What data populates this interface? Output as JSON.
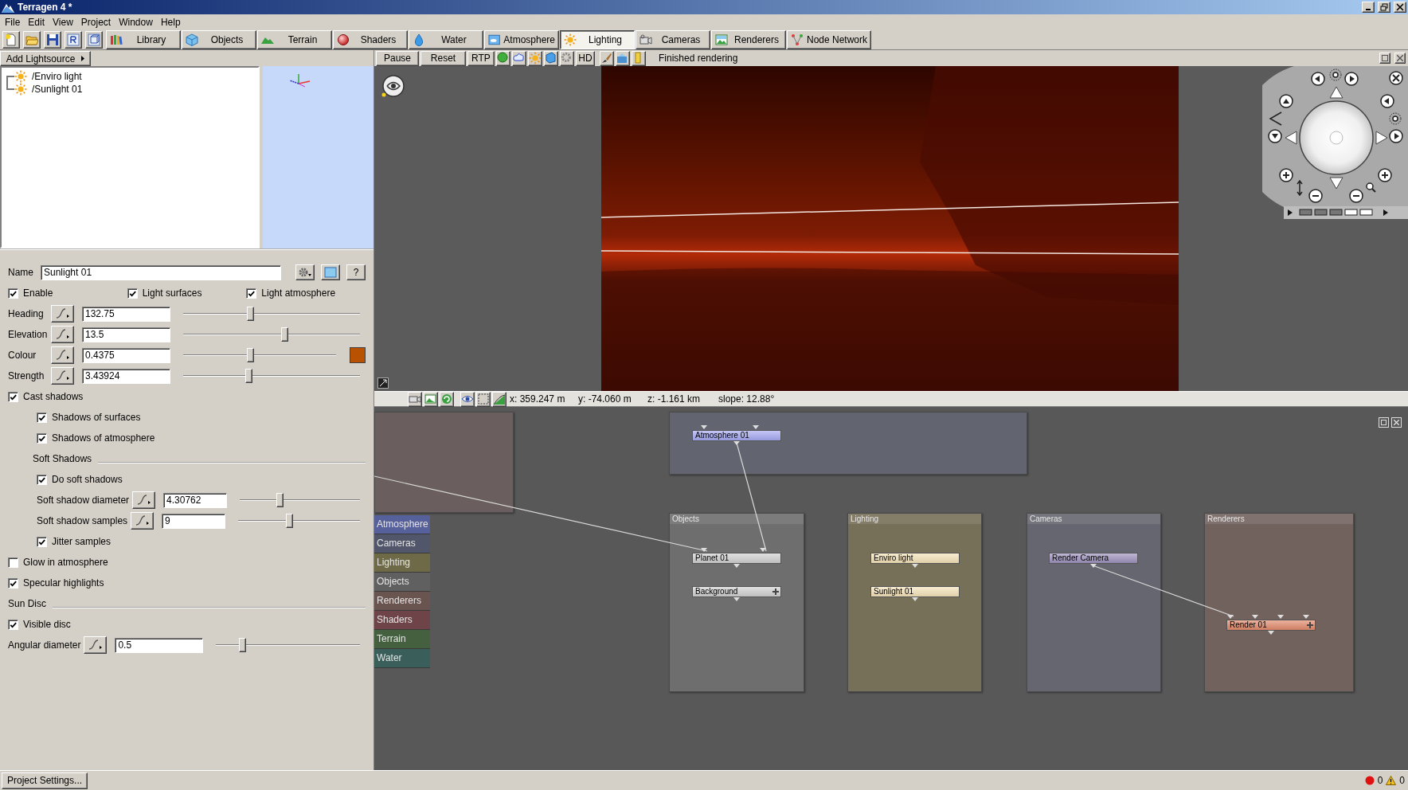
{
  "window": {
    "title": "Terragen 4 *"
  },
  "menu": [
    "File",
    "Edit",
    "View",
    "Project",
    "Window",
    "Help"
  ],
  "toolbar": {
    "tabs": [
      {
        "label": "Library",
        "selected": false
      },
      {
        "label": "Objects",
        "selected": false
      },
      {
        "label": "Terrain",
        "selected": false
      },
      {
        "label": "Shaders",
        "selected": false
      },
      {
        "label": "Water",
        "selected": false
      },
      {
        "label": "Atmosphere",
        "selected": false
      },
      {
        "label": "Lighting",
        "selected": true
      },
      {
        "label": "Cameras",
        "selected": false
      },
      {
        "label": "Renderers",
        "selected": false
      },
      {
        "label": "Node Network",
        "selected": false
      }
    ]
  },
  "light_list": {
    "add_button": "Add Lightsource",
    "items": [
      {
        "label": "/Enviro light",
        "selected": false
      },
      {
        "label": "/Sunlight 01",
        "selected": false
      }
    ]
  },
  "properties": {
    "name_label": "Name",
    "name_value": "Sunlight 01",
    "help_button": "?",
    "rows": [
      {
        "kind": "checks",
        "items": [
          {
            "label": "Enable",
            "checked": true
          },
          {
            "label": "Light surfaces",
            "checked": true
          },
          {
            "label": "Light atmosphere",
            "checked": true
          }
        ]
      },
      {
        "kind": "param",
        "label": "Heading",
        "value": "132.75",
        "level": 0.38
      },
      {
        "kind": "param",
        "label": "Elevation",
        "value": "13.5",
        "level": 0.57
      },
      {
        "kind": "param",
        "label": "Colour",
        "value": "0.4375",
        "level": 0.44,
        "color": "#b85200"
      },
      {
        "kind": "param",
        "label": "Strength",
        "value": "3.43924",
        "level": 0.37
      },
      {
        "kind": "check",
        "label": "Cast shadows",
        "checked": true,
        "children": [
          {
            "kind": "check",
            "label": "Shadows of surfaces",
            "checked": true
          },
          {
            "kind": "check",
            "label": "Shadows of atmosphere",
            "checked": true
          },
          {
            "kind": "section",
            "label": "Soft Shadows"
          },
          {
            "kind": "check",
            "label": "Do soft shadows",
            "checked": true
          },
          {
            "kind": "param",
            "label": "Soft shadow diameter",
            "value": "4.30762",
            "level": 0.33
          },
          {
            "kind": "param",
            "label": "Soft shadow samples",
            "value": "9",
            "level": 0.42
          },
          {
            "kind": "check",
            "label": "Jitter samples",
            "checked": true
          }
        ]
      },
      {
        "kind": "check",
        "label": "Glow in atmosphere",
        "checked": false
      },
      {
        "kind": "check",
        "label": "Specular highlights",
        "checked": true
      },
      {
        "kind": "section",
        "label": "Sun Disc"
      },
      {
        "kind": "check",
        "label": "Visible disc",
        "checked": true
      },
      {
        "kind": "param",
        "label": "Angular diameter",
        "value": "0.5",
        "level": 0.18
      }
    ]
  },
  "viewport": {
    "buttons": [
      "Pause",
      "Reset",
      "RTP"
    ],
    "hd_button": "HD",
    "status": "Finished rendering"
  },
  "coordinates": [
    "x: 359.247 m",
    "y: -74.060 m",
    "z: -1.161 km",
    "slope: 12.88°"
  ],
  "node_network": {
    "categories": [
      {
        "label": "Atmosphere",
        "color": "#56609a"
      },
      {
        "label": "Cameras",
        "color": "#52566a"
      },
      {
        "label": "Lighting",
        "color": "#6e6a48"
      },
      {
        "label": "Objects",
        "color": "#606060"
      },
      {
        "label": "Renderers",
        "color": "#6a5450"
      },
      {
        "label": "Shaders",
        "color": "#6e4448"
      },
      {
        "label": "Terrain",
        "color": "#44603e"
      },
      {
        "label": "Water",
        "color": "#3a5e5a"
      }
    ],
    "groups": [
      {
        "color": "#6a5e5e"
      },
      {
        "color": "#626470",
        "nodes": [
          {
            "label": "Atmosphere 01",
            "color": "#a4a8f0"
          }
        ]
      },
      {
        "title": "Objects",
        "color": "#6e6e6e",
        "nodes": [
          {
            "label": "Planet 01",
            "color": "#cfcfcf"
          },
          {
            "label": "Background",
            "color": "#cfcfcf",
            "expandable": true
          }
        ]
      },
      {
        "title": "Lighting",
        "color": "#767058",
        "nodes": [
          {
            "label": "Enviro light",
            "color": "#f4e2b8"
          },
          {
            "label": "Sunlight 01",
            "color": "#f4e2b8"
          }
        ]
      },
      {
        "title": "Cameras",
        "color": "#666670",
        "nodes": [
          {
            "label": "Render Camera",
            "color": "#9c90bc"
          }
        ]
      },
      {
        "title": "Renderers",
        "color": "#72625e",
        "nodes": [
          {
            "label": "Render 01",
            "color": "#e0886a",
            "expandable": true
          }
        ]
      }
    ]
  },
  "status_bar": {
    "button": "Project Settings...",
    "errors": "0",
    "warnings": "0"
  }
}
